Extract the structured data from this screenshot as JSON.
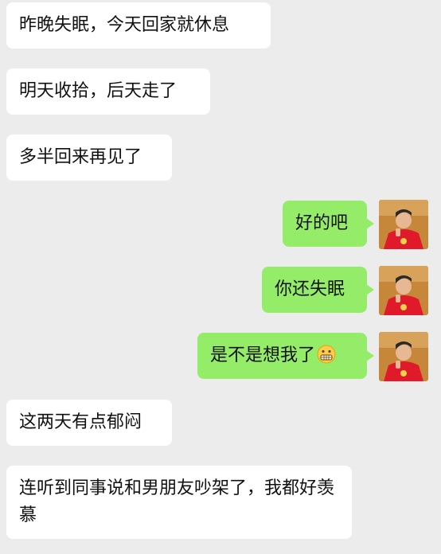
{
  "messages": [
    {
      "side": "in",
      "text": "昨晚失眠，今天回家就休息"
    },
    {
      "side": "in",
      "text": "明天收拾，后天走了"
    },
    {
      "side": "in",
      "text": "多半回来再见了"
    },
    {
      "side": "out",
      "text": "好的吧"
    },
    {
      "side": "out",
      "text": "你还失眠"
    },
    {
      "side": "out",
      "text": "是不是想我了",
      "emoji": "grimacing-face-emoji"
    },
    {
      "side": "in",
      "text": "这两天有点郁闷"
    },
    {
      "side": "in",
      "text": "连听到同事说和男朋友吵架了，我都好羡慕"
    }
  ],
  "colors": {
    "background": "#ececec",
    "incoming_bubble": "#ffffff",
    "outgoing_bubble": "#95ec69"
  },
  "icons": {
    "self_avatar": "avatar-photo-red-shirt"
  }
}
